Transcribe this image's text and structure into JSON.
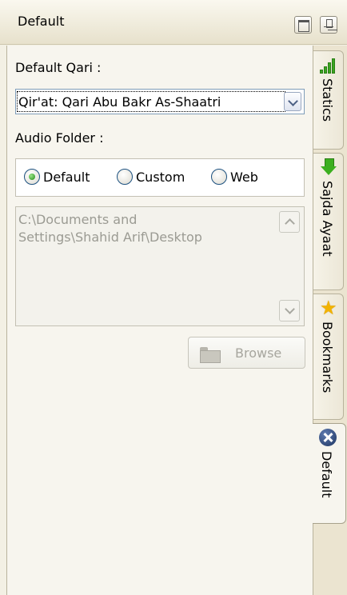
{
  "window": {
    "title": "Default"
  },
  "form": {
    "qari_label": "Default Qari :",
    "qari_selected": "Qir'at: Qari Abu Bakr As-Shaatri",
    "audio_folder_label": "Audio Folder :",
    "radio_options": [
      {
        "label": "Default",
        "selected": true
      },
      {
        "label": "Custom",
        "selected": false
      },
      {
        "label": "Web",
        "selected": false
      }
    ],
    "folder_path_line1": "C:\\Documents and",
    "folder_path_line2": "Settings\\Shahid Arif\\Desktop",
    "browse_label": "Browse"
  },
  "tabs": [
    {
      "label": "Statics",
      "icon": "signal-bars-icon",
      "active": false
    },
    {
      "label": "Sajda Ayaat",
      "icon": "down-arrow-icon",
      "active": false
    },
    {
      "label": "Bookmarks",
      "icon": "star-icon",
      "active": false
    },
    {
      "label": "Default",
      "icon": "tools-icon",
      "active": true
    }
  ],
  "colors": {
    "panel_bg": "#f7f5ee",
    "titlebar_bg": "#e7e1cc",
    "disabled_text": "#9b9b93",
    "radio_selected": "#1f8a12"
  }
}
